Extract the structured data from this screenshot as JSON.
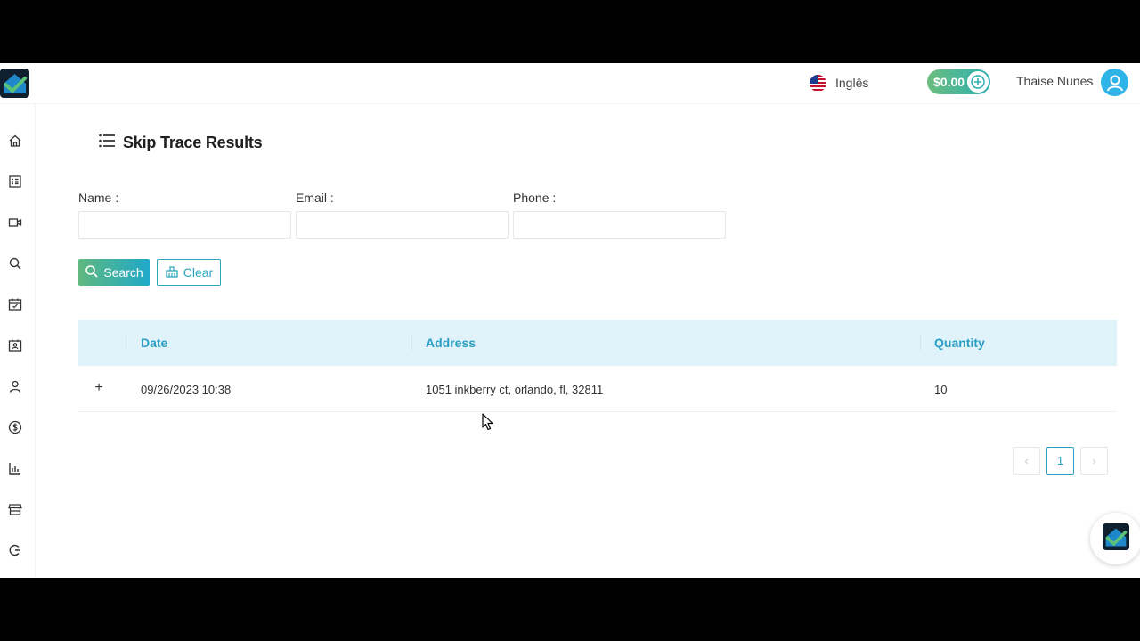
{
  "header": {
    "language": "Inglês",
    "balance": "$0.00",
    "user_name": "Thaise Nunes"
  },
  "sidebar": {
    "items": [
      {
        "icon": "home-icon"
      },
      {
        "icon": "list-icon"
      },
      {
        "icon": "video-icon"
      },
      {
        "icon": "search-icon"
      },
      {
        "icon": "calendar-icon"
      },
      {
        "icon": "contact-card-icon"
      },
      {
        "icon": "user-icon"
      },
      {
        "icon": "dollar-icon"
      },
      {
        "icon": "bar-chart-icon"
      },
      {
        "icon": "store-icon"
      },
      {
        "icon": "logout-icon"
      }
    ]
  },
  "page": {
    "title": "Skip Trace Results"
  },
  "filters": {
    "name_label": "Name :",
    "email_label": "Email :",
    "phone_label": "Phone :",
    "name_value": "",
    "email_value": "",
    "phone_value": ""
  },
  "buttons": {
    "search": "Search",
    "clear": "Clear"
  },
  "table": {
    "columns": [
      "Date",
      "Address",
      "Quantity"
    ],
    "rows": [
      {
        "expand": "+",
        "date": "09/26/2023 10:38",
        "address": "1051 inkberry ct, orlando, fl, 32811",
        "quantity": "10"
      }
    ]
  },
  "pagination": {
    "prev": "‹",
    "current": "1",
    "next": "›"
  },
  "colors": {
    "accent": "#2a9fc4",
    "header_bg": "#e0f3fb",
    "gradient_start": "#5fb87f",
    "gradient_end": "#1fa9c9"
  }
}
